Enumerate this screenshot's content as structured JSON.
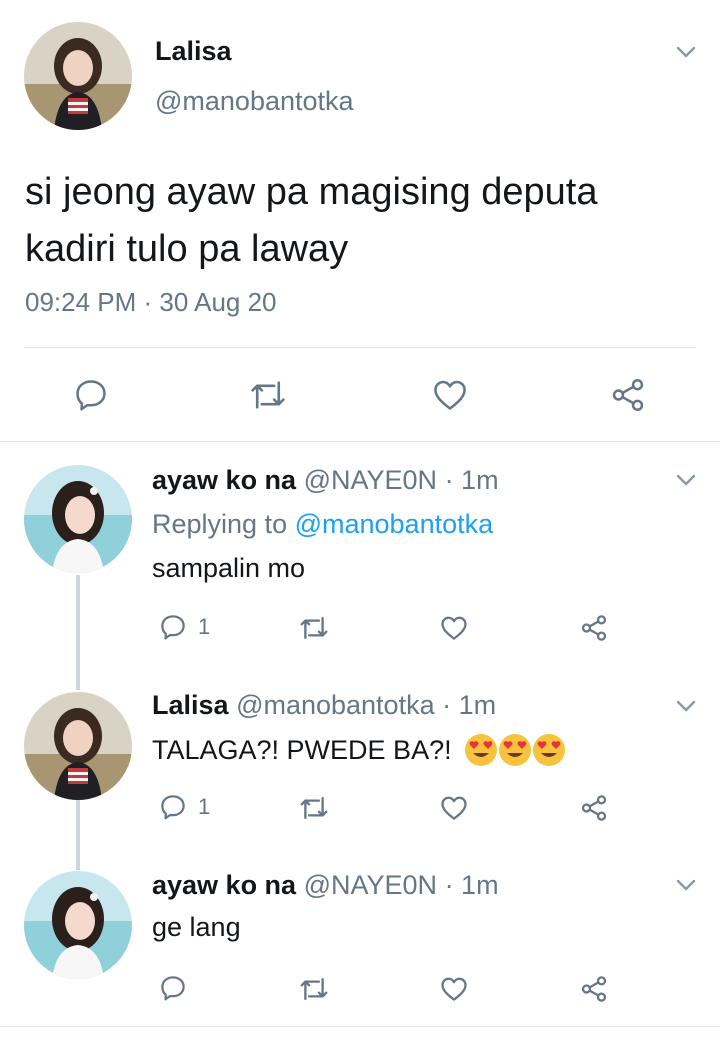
{
  "main_tweet": {
    "display_name": "Lalisa",
    "handle": "@manobantotka",
    "text_line1": "si jeong ayaw pa magising deputa",
    "text_line2": "kadiri tulo pa laway",
    "timestamp": "09:24 PM · 30 Aug 20",
    "actions": [
      "reply-icon",
      "retweet-icon",
      "like-icon",
      "share-icon"
    ]
  },
  "replies": [
    {
      "display_name": "ayaw ko na",
      "handle": "@NAYE0N",
      "time": "· 1m",
      "replying_prefix": "Replying to ",
      "replying_handle": "@manobantotka",
      "text": "sampalin mo",
      "reply_count": "1"
    },
    {
      "display_name": "Lalisa",
      "handle": "@manobantotka",
      "time": "· 1m",
      "text": "TALAGA?! PWEDE BA?!",
      "emoji": [
        "heart-eyes-emoji",
        "heart-eyes-emoji",
        "heart-eyes-emoji"
      ],
      "reply_count": "1"
    },
    {
      "display_name": "ayaw ko na",
      "handle": "@NAYE0N",
      "time": "· 1m",
      "text": "ge lang",
      "reply_count": ""
    }
  ],
  "colors": {
    "text": "#14171a",
    "secondary": "#657786",
    "link": "#1da1f2",
    "divider": "#e1e8ed"
  }
}
